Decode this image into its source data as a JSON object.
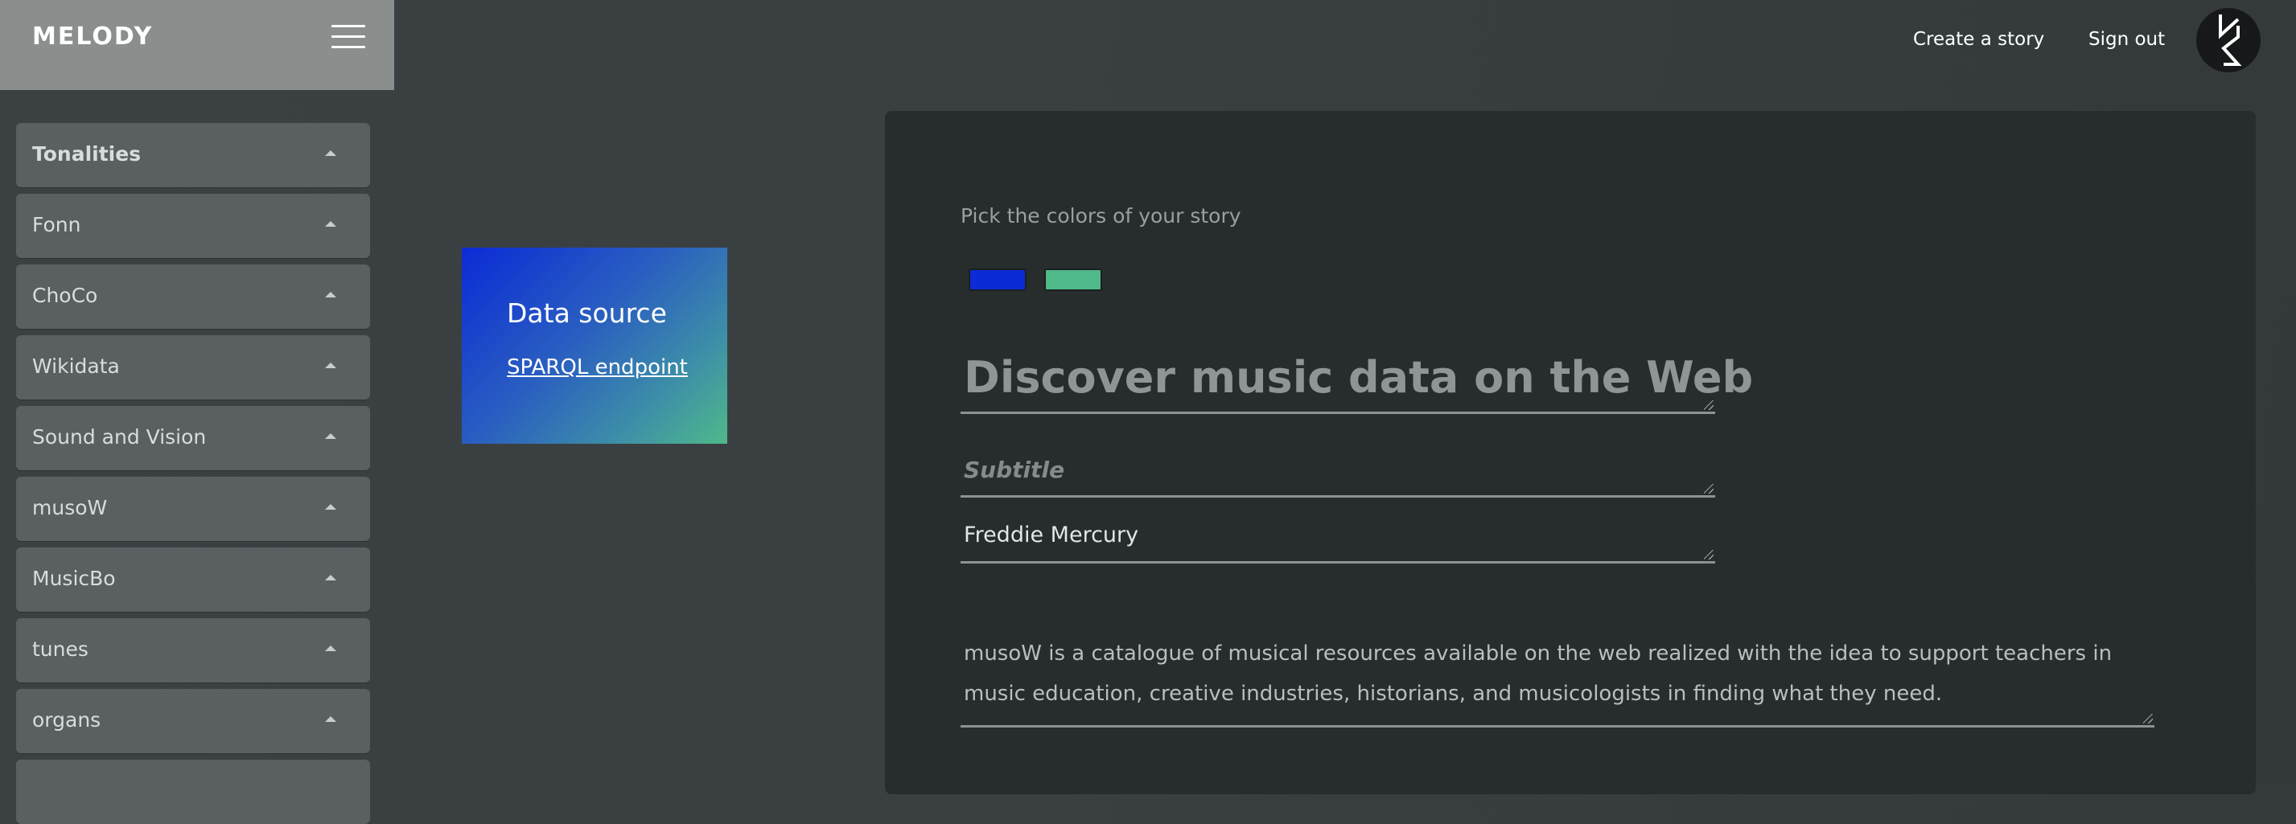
{
  "header": {
    "brand": "MELODY",
    "menu_icon": "hamburger-menu-icon",
    "create_story": "Create a story",
    "sign_out": "Sign out",
    "avatar_icon": "logo-avatar-icon"
  },
  "sidebar": {
    "items": [
      {
        "label": "Tonalities"
      },
      {
        "label": "Fonn"
      },
      {
        "label": "ChoCo"
      },
      {
        "label": "Wikidata"
      },
      {
        "label": "Sound and Vision"
      },
      {
        "label": "musoW"
      },
      {
        "label": "MusicBo"
      },
      {
        "label": "tunes"
      },
      {
        "label": "organs"
      }
    ],
    "caret_icon": "caret-up-icon"
  },
  "data_source": {
    "title": "Data source",
    "link": "SPARQL endpoint",
    "gradient_colors": [
      "#0b2bd6",
      "#4fb98a"
    ]
  },
  "editor": {
    "pick_colors_label": "Pick the colors of your story",
    "colors": [
      "#0b2bd6",
      "#4fb98a"
    ],
    "title_placeholder": "Discover music data on the Web",
    "subtitle_placeholder": "Subtitle",
    "author_value": "Freddie Mercury",
    "description_value": "musoW is a catalogue of musical resources available on the web realized with the idea to support teachers in music education, creative industries, historians, and musicologists in finding what they need."
  }
}
